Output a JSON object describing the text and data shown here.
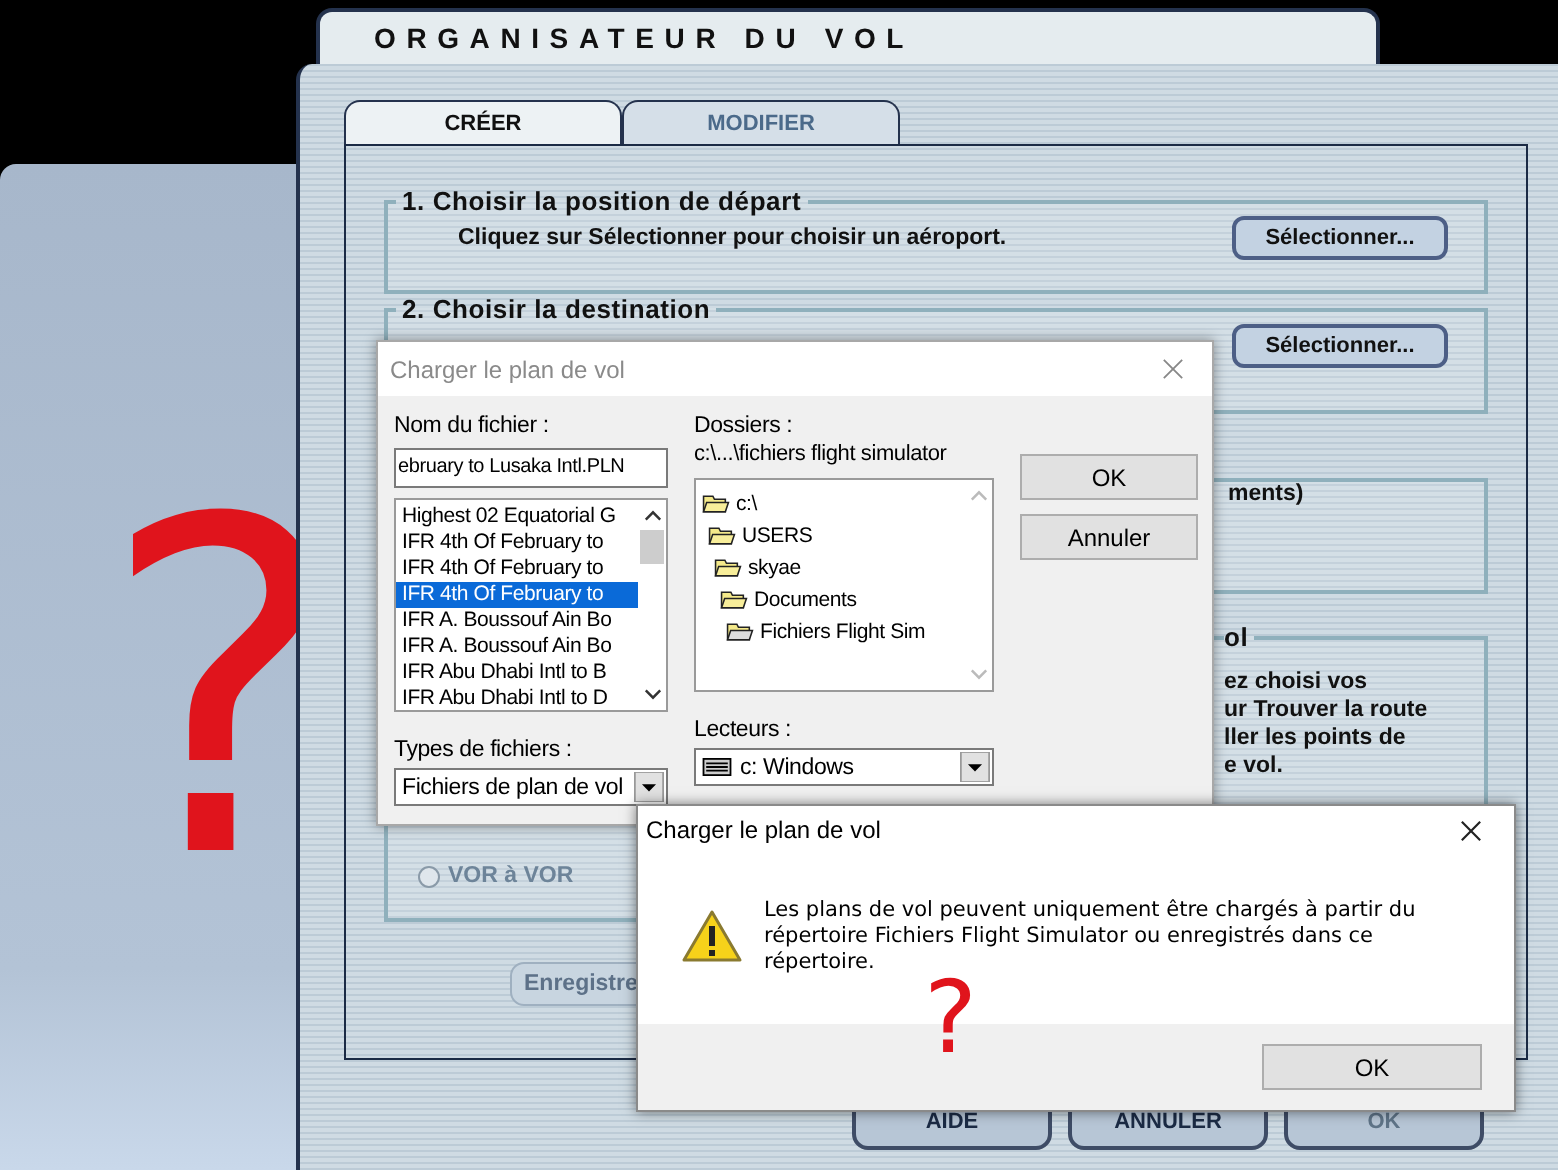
{
  "planner": {
    "title": "ORGANISATEUR DU VOL",
    "tabs": [
      {
        "label": "CRÉER",
        "selected": true
      },
      {
        "label": "MODIFIER",
        "selected": false
      }
    ],
    "step_1": {
      "heading": "1. Choisir la position de départ",
      "instruction": "Cliquez sur Sélectionner pour choisir un aéroport.",
      "button": "Sélectionner..."
    },
    "step_2": {
      "heading": "2. Choisir la destination",
      "button": "Sélectionner..."
    },
    "step_3": {
      "text": "ments)"
    },
    "step_4": {
      "heading": "ol",
      "text_lines": [
        "ez choisi vos",
        "ur Trouver la route",
        "ller les points de",
        "e vol."
      ],
      "radio": {
        "label": "VOR à VOR",
        "selected": false
      }
    },
    "save_button": "Enregistre",
    "buttons": [
      {
        "label": "AIDE",
        "disabled": false
      },
      {
        "label": "ANNULER",
        "disabled": false
      },
      {
        "label": "OK",
        "disabled": true
      }
    ]
  },
  "file_dialog": {
    "title": "Charger le plan de vol",
    "file_name_label": "Nom du fichier :",
    "file_name": "ebruary to Lusaka Intl.PLN",
    "files": [
      {
        "name": "Highest 02 Equatorial G",
        "selected": false
      },
      {
        "name": "IFR 4th Of February to",
        "selected": false
      },
      {
        "name": "IFR 4th Of February to",
        "selected": false
      },
      {
        "name": "IFR 4th Of February to",
        "selected": true
      },
      {
        "name": "IFR A. Boussouf Ain Bo",
        "selected": false
      },
      {
        "name": "IFR A. Boussouf Ain Bo",
        "selected": false
      },
      {
        "name": "IFR Abu Dhabi Intl to B",
        "selected": false
      },
      {
        "name": "IFR Abu Dhabi Intl to D",
        "selected": false
      }
    ],
    "file_types_label": "Types de fichiers :",
    "file_type": "Fichiers de plan de vol",
    "folders_label": "Dossiers :",
    "folder_path": "c:\\...\\fichiers flight simulator",
    "folders": [
      {
        "name": "c:\\",
        "children": [
          {
            "name": "USERS",
            "children": [
              {
                "name": "skyae",
                "children": [
                  {
                    "name": "Documents",
                    "children": [
                      {
                        "name": "Fichiers Flight Sim"
                      }
                    ]
                  }
                ]
              }
            ]
          }
        ]
      }
    ],
    "drives_label": "Lecteurs :",
    "drive": "c: Windows",
    "buttons": [
      "OK",
      "Annuler"
    ]
  },
  "message_box": {
    "title": "Charger le plan de vol",
    "message": "Les plans de vol peuvent uniquement être chargés à partir du répertoire Fichiers Flight Simulator ou enregistrés dans ce répertoire.",
    "button": "OK"
  },
  "annotations": [
    "?",
    "?"
  ]
}
